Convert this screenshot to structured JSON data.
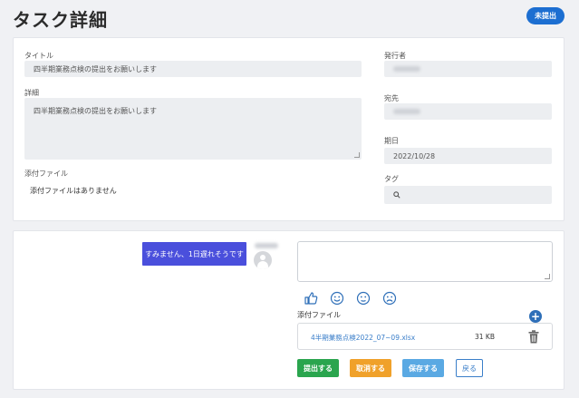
{
  "page": {
    "title": "タスク詳細",
    "status_badge": "未提出"
  },
  "details": {
    "title_label": "タイトル",
    "title_value": "四半期業務点検の提出をお願いします",
    "detail_label": "詳細",
    "detail_value": "四半期業務点検の提出をお願いします",
    "attachment_label": "添付ファイル",
    "attachment_none": "添付ファイルはありません",
    "issuer_label": "発行者",
    "recipient_label": "宛先",
    "due_label": "期日",
    "due_value": "2022/10/28",
    "tag_label": "タグ"
  },
  "submission": {
    "chat_message": "すみません、1日遅れそうです",
    "attachment_label": "添付ファイル",
    "file": {
      "name": "4半期業務点検2022_07~09.xlsx",
      "size": "31 KB"
    },
    "reaction_icons": [
      "thumbs-up-icon",
      "smile-icon",
      "neutral-face-icon",
      "frown-icon"
    ],
    "buttons": {
      "submit": "提出する",
      "withdraw": "取消する",
      "save": "保存する",
      "back": "戻る"
    }
  },
  "colors": {
    "accent": "#1c6ed1",
    "chat": "#4a4fdc",
    "submit": "#2aa54e",
    "withdraw": "#f0a12a",
    "save": "#5aa9e3"
  }
}
